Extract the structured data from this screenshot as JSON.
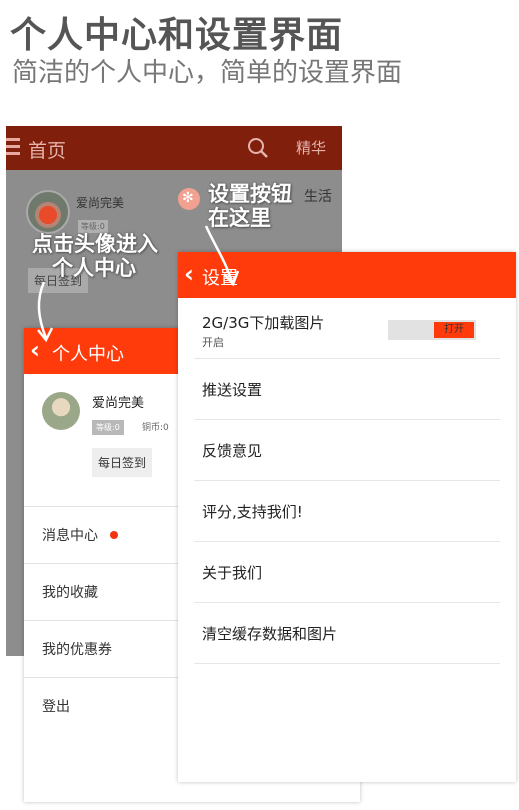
{
  "heading": {
    "title": "个人中心和设置界面",
    "subtitle": "简洁的个人中心，简单的设置界面"
  },
  "home": {
    "title": "首页",
    "tab": "精华",
    "user_name": "爱尚完美",
    "level": "等级:0",
    "checkin": "每日签到",
    "category": "生活",
    "icons": [
      "menu-icon",
      "search-icon",
      "gear-icon"
    ]
  },
  "profile": {
    "title": "个人中心",
    "user_name": "爱尚完美",
    "level": "等级:0",
    "coins": "铜币:0",
    "checkin": "每日签到",
    "items": [
      {
        "label": "消息中心",
        "badge": true
      },
      {
        "label": "我的收藏"
      },
      {
        "label": "我的优惠券"
      },
      {
        "label": "登出"
      }
    ]
  },
  "settings": {
    "title": "设置",
    "items": [
      {
        "label": "2G/3G下加载图片",
        "sub": "开启",
        "toggle": "打开"
      },
      {
        "label": "推送设置"
      },
      {
        "label": "反馈意见"
      },
      {
        "label": "评分,支持我们!"
      },
      {
        "label": "关于我们"
      },
      {
        "label": "清空缓存数据和图片"
      }
    ]
  },
  "annotations": {
    "avatar_line1": "点击头像进入",
    "avatar_line2": "个人中心",
    "gear_line1": "设置按钮",
    "gear_line2": "在这里"
  },
  "colors": {
    "accent": "#ff3b0b",
    "home_bar": "#7f1f0c",
    "badge": "#f2330e"
  }
}
